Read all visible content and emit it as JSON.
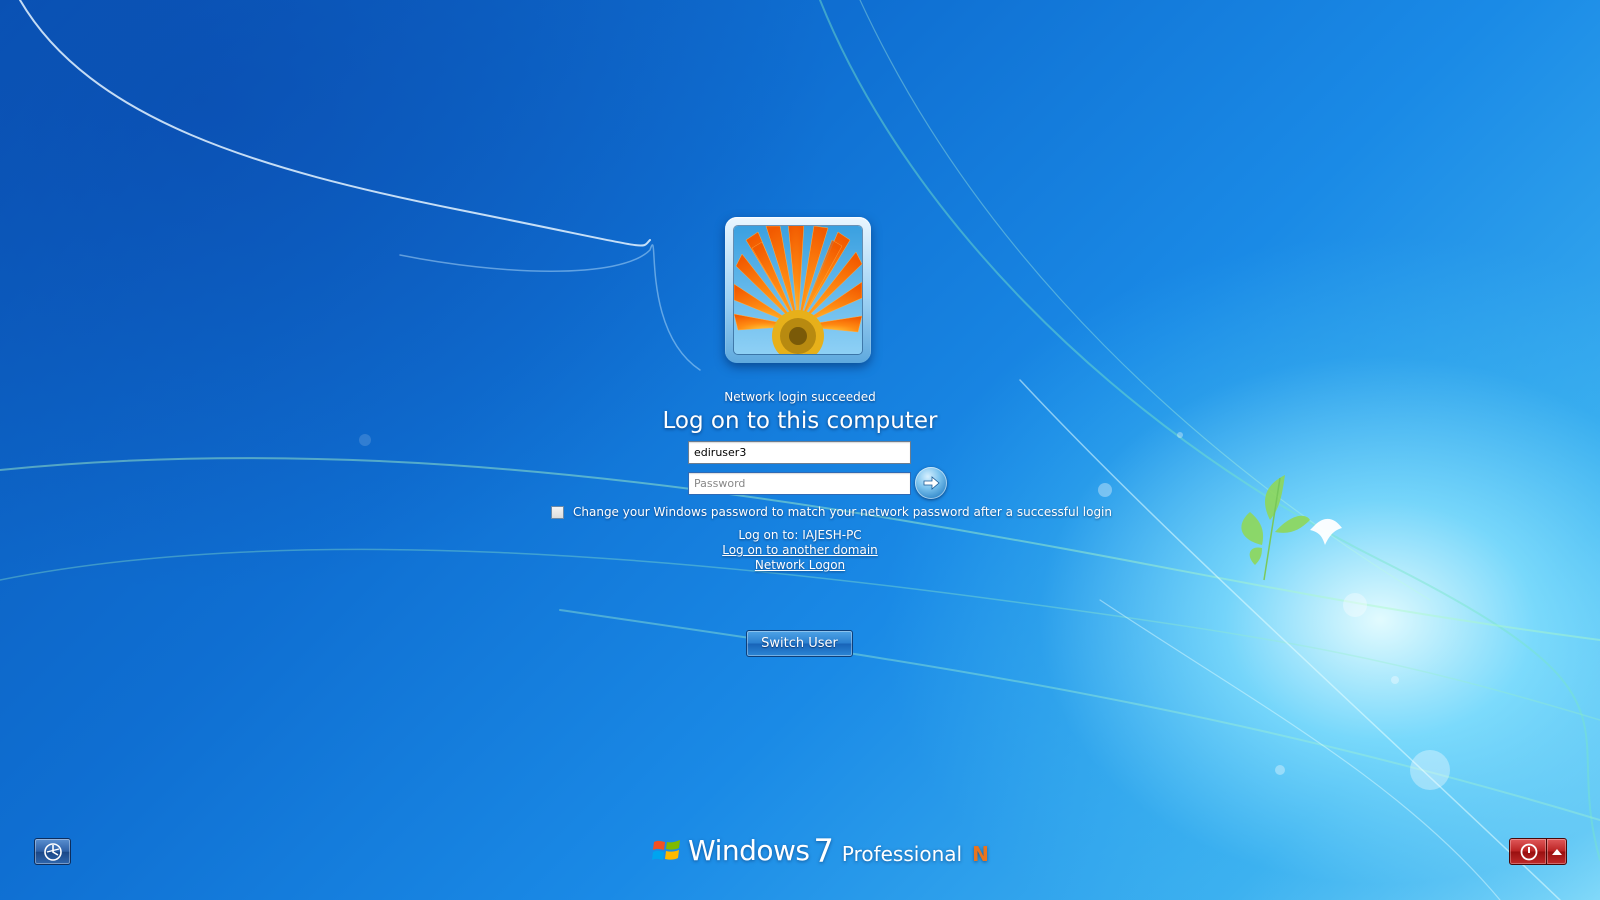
{
  "window": {
    "title": "Log on to this computer"
  },
  "avatar": {
    "icon": "orange-gerbera-flower"
  },
  "login": {
    "status": "Network login succeeded",
    "heading": "Log on to this computer",
    "username_value": "ediruser3",
    "password_placeholder": "Password",
    "submit_icon": "arrow-right-icon"
  },
  "options": {
    "change_password_label": "Change your Windows password to match your network password after a successful login",
    "change_password_checked": false,
    "logon_to": "Log on to: IAJESH-PC",
    "another_domain_link": "Log on to another domain",
    "network_logon_link": "Network Logon"
  },
  "actions": {
    "switch_user_label": "Switch User"
  },
  "bottom": {
    "ease_of_access_icon": "ease-of-access-icon",
    "power_icon": "power-icon",
    "power_menu_icon": "caret-up-icon"
  },
  "branding": {
    "windows": "Windows",
    "version": "7",
    "edition": "Professional",
    "edition_suffix": "N",
    "suffix_color": "#e8741e"
  }
}
